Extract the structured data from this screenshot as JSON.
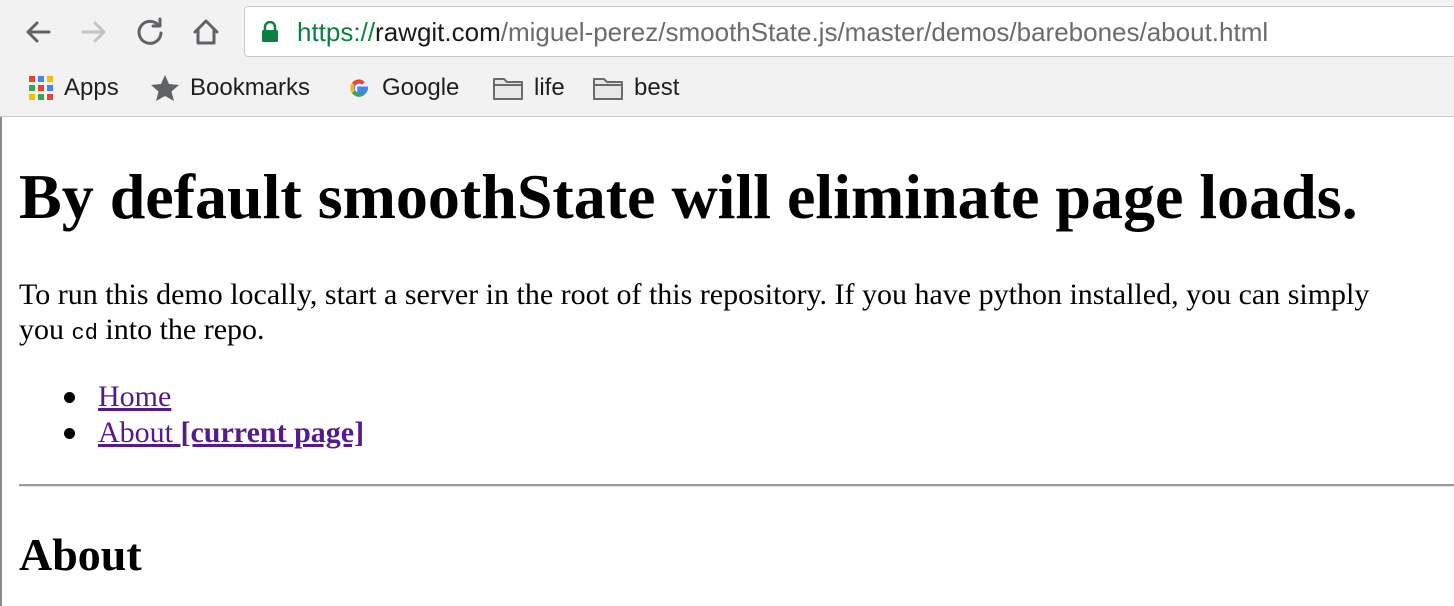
{
  "browser": {
    "address_bar": {
      "scheme": "https://",
      "host": "rawgit.com",
      "path": "/miguel-perez/smoothState.js/master/demos/barebones/about.html"
    },
    "bookmarks": [
      {
        "label": "Apps",
        "icon": "apps-grid-icon"
      },
      {
        "label": "Bookmarks",
        "icon": "star-icon"
      },
      {
        "label": "Google",
        "icon": "google-icon"
      },
      {
        "label": "life",
        "icon": "folder-icon"
      },
      {
        "label": "best",
        "icon": "folder-icon"
      }
    ],
    "colors": {
      "secure_green": "#0b8043",
      "visited_link": "#551a8b"
    }
  },
  "page": {
    "title": "By default smoothState will eliminate page loads.",
    "intro": {
      "line1": "To run this demo locally, start a server in the root of this repository. If you have python installed, you can simply",
      "line2_before": "you ",
      "code": "cd",
      "line2_after": " into the repo."
    },
    "nav": {
      "home_label": "Home",
      "about_label": "About",
      "current_label": "[current page]"
    },
    "section_title": "About"
  }
}
